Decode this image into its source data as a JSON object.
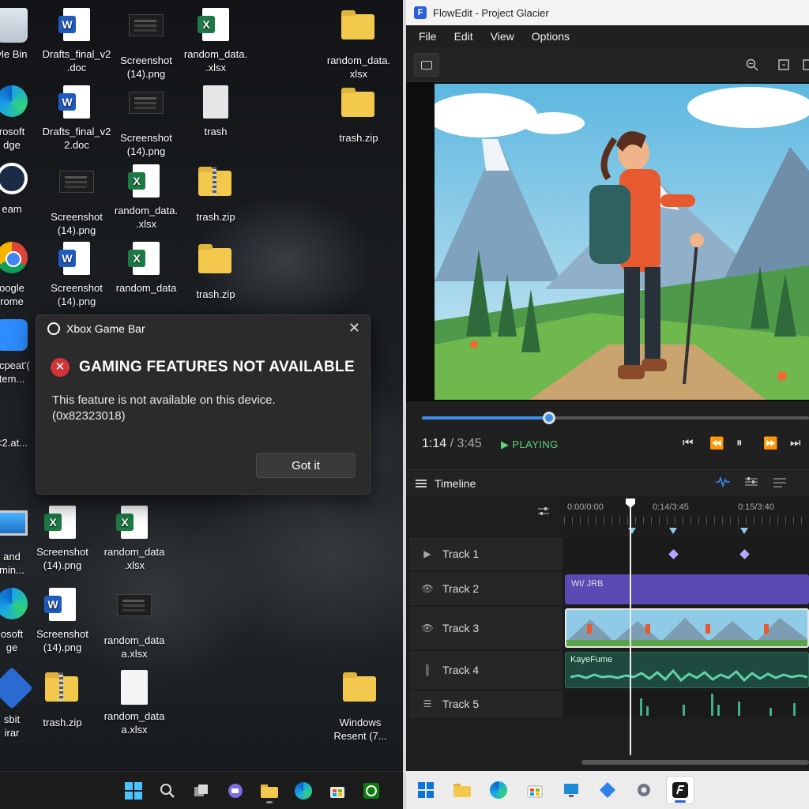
{
  "desktop": {
    "icons": [
      {
        "label": "yle Bin"
      },
      {
        "label": "Drafts_final_v2\n.doc"
      },
      {
        "label": "Screenshot\n(14).png"
      },
      {
        "label": "random_data.\n.xlsx"
      },
      {
        "label": "random_data.\nxlsx"
      },
      {
        "label": "rosoft\ndge"
      },
      {
        "label": "Drafts_final_v2\n2.doc"
      },
      {
        "label": "Screenshot\n(14).png"
      },
      {
        "label": "trash"
      },
      {
        "label": "trash.zip"
      },
      {
        "label": "eam"
      },
      {
        "label": "Screenshot\n(14).png"
      },
      {
        "label": "random_data.\n.xlsx"
      },
      {
        "label": "trash.zip"
      },
      {
        "label": "oogle\nrome"
      },
      {
        "label": "Screenshot\n(14).png"
      },
      {
        "label": "random_data"
      },
      {
        "label": "trash.zip"
      },
      {
        "label": "ccpeat'(\ntem..."
      },
      {
        "label": "<2.at..."
      },
      {
        "label": "and\nmin..."
      },
      {
        "label": "Screenshot\n(14).png"
      },
      {
        "label": "random_data\n.xlsx"
      },
      {
        "label": "osoft\nge"
      },
      {
        "label": "Screenshot\n(14).png"
      },
      {
        "label": "random_data\na.xlsx"
      },
      {
        "label": "sbit\nirar"
      },
      {
        "label": "trash.zip"
      },
      {
        "label": "random_data\na.xlsx"
      },
      {
        "label": "Windows\nResent (7..."
      }
    ]
  },
  "dialog": {
    "app_name": "Xbox Game Bar",
    "close_glyph": "✕",
    "error_glyph": "✕",
    "title": "GAMING FEATURES NOT AVAILABLE",
    "message_line1": "This feature is not available on this device.",
    "message_line2": "(0x82323018)",
    "button_label": "Got it"
  },
  "app": {
    "window_title": "FlowEdit - Project Glacier",
    "logo_glyph": "F",
    "menu": [
      "File",
      "Edit",
      "View",
      "Options"
    ],
    "toolbar_icons": [
      "camera-icon",
      "zoom-icon",
      "crop-icon"
    ],
    "player": {
      "current_time": "1:14",
      "separator": " / ",
      "total_time": "3:45",
      "state_glyph": "▶",
      "state": "PLAYING",
      "progress": 0.329,
      "controls": {
        "prev": "⏮",
        "rewind": "⏪",
        "pause": "⏸",
        "forward": "⏩",
        "next": "⏭"
      }
    },
    "timeline": {
      "title": "Timeline",
      "ruler_labels": [
        "0:00/0:00",
        "0:14/3:45",
        "0:15/3:40"
      ],
      "tracks": [
        {
          "name": "Track 1",
          "icon": "▶",
          "clip_label": ""
        },
        {
          "name": "Track 2",
          "icon": "👁",
          "clip_label": "Wt/ JRB"
        },
        {
          "name": "Track 3",
          "icon": "👁",
          "clip_label": ""
        },
        {
          "name": "Track 4",
          "icon": "║",
          "clip_label": "KayeFume"
        },
        {
          "name": "Track 5",
          "icon": "☰",
          "clip_label": ""
        }
      ]
    }
  },
  "colors": {
    "accent": "#3b8eea",
    "playing": "#5fd37a",
    "error": "#d13438",
    "clip_purple": "#5b4ab3",
    "audio_green": "#3fae8c"
  }
}
